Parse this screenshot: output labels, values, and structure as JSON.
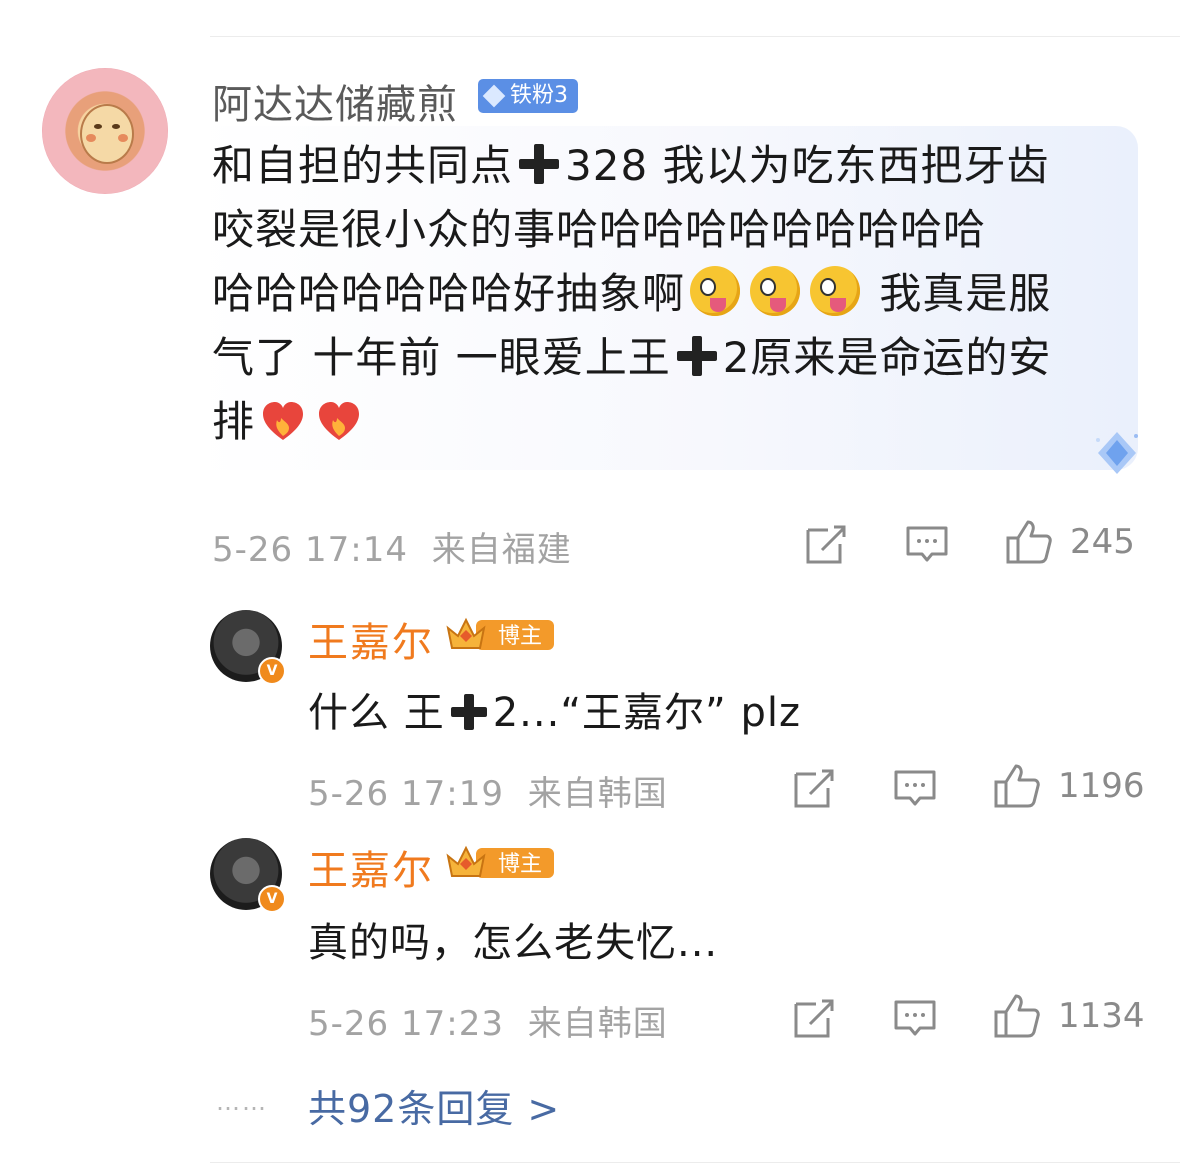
{
  "comment": {
    "author": "阿达达储藏煎",
    "fan_badge": "铁粉3",
    "text_lines": [
      [
        "和自担的共同点",
        "plus",
        "328 我以为吃东西把牙齿"
      ],
      [
        "咬裂是很小众的事哈哈哈哈哈哈哈哈哈哈"
      ],
      [
        "哈哈哈哈哈哈哈好抽象啊",
        "emoji",
        "emoji",
        "emoji",
        " 我真是服"
      ],
      [
        "气了 十年前 一眼爱上王",
        "plus",
        "2原来是命运的安"
      ],
      [
        "排",
        "heart",
        "heart"
      ]
    ],
    "timestamp": "5-26 17:14",
    "location": "来自福建",
    "likes": "245"
  },
  "replies": [
    {
      "author": "王嘉尔",
      "role_badge": "博主",
      "text_a": "什么 王",
      "text_b": "2...“王嘉尔” plz",
      "timestamp": "5-26 17:19",
      "location": "来自韩国",
      "likes": "1196"
    },
    {
      "author": "王嘉尔",
      "role_badge": "博主",
      "text": "真的吗，怎么老失忆...",
      "timestamp": "5-26 17:23",
      "location": "来自韩国",
      "likes": "1134"
    }
  ],
  "more_replies": {
    "dots": "……",
    "label": "共92条回复 >"
  },
  "icons": {
    "share": "share-icon",
    "comment": "comment-icon",
    "like": "thumbs-up-icon",
    "verified": "verified-v-icon"
  },
  "colors": {
    "author_orange": "#f07a1e",
    "link_blue": "#486aa3",
    "fan_badge_blue": "#5b8fe5"
  }
}
